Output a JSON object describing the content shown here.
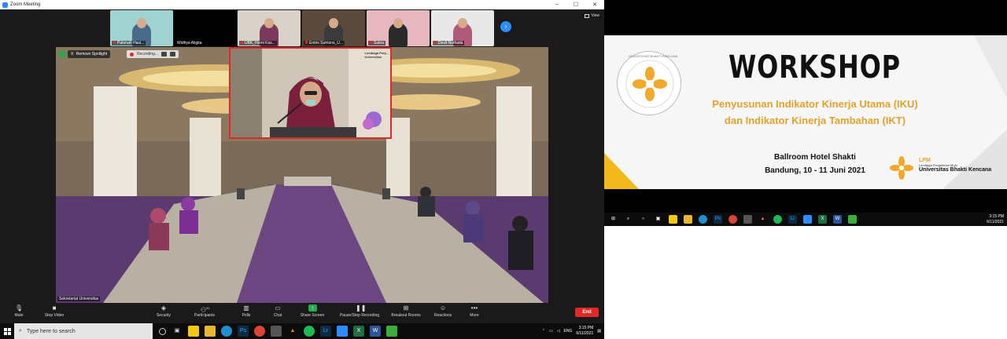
{
  "window": {
    "title": "Zoom Meeting",
    "controls": [
      "–",
      "☐",
      "✕"
    ]
  },
  "gallery": {
    "view_label": "View",
    "participants": [
      {
        "name": "Patonah Hasi...",
        "bg": "#9fd2d0",
        "outfit": "#4a6a8a"
      },
      {
        "name": "Widhya Aligita",
        "bg": "#000000",
        "outfit": "#000000"
      },
      {
        "name": "UBK_Hemi Kas...",
        "bg": "#d8d2c8",
        "outfit": "#7a3b5a"
      },
      {
        "name": "Entris Sutrisno_U...",
        "bg": "#5a4a3e",
        "outfit": "#3a3a3a"
      },
      {
        "name": "Sutna",
        "bg": "#e8b8c0",
        "outfit": "#2a2a2a"
      },
      {
        "name": "Devil Nurfaida",
        "bg": "#e8e8e8",
        "outfit": "#b05a7a"
      }
    ]
  },
  "spotlight": {
    "remove_label": "Remove Spotlight",
    "recording_label": "Recording...",
    "participant_label": "Sekretariat Universitas"
  },
  "pip": {
    "logo_line1": "Lembaga Penj...",
    "logo_line2": "Universitas"
  },
  "toolbar": {
    "mute": "Mute",
    "stop_video": "Stop Video",
    "security": "Security",
    "participants": "Participants",
    "participants_count": "41",
    "polls": "Polls",
    "chat": "Chat",
    "share_screen": "Share Screen",
    "recording": "Pause/Stop Recording",
    "breakout": "Breakout Rooms",
    "reactions": "Reactions",
    "more": "More",
    "end": "End"
  },
  "taskbar": {
    "search_placeholder": "Type here to search",
    "time": "3:15 PM",
    "date": "6/11/2021",
    "lang": "ENG"
  },
  "slide": {
    "title": "WORKSHOP",
    "subtitle1": "Penyusunan Indikator Kinerja Utama (IKU)",
    "subtitle2": "dan Indikator Kinerja Tambahan (IKT)",
    "venue": "Ballroom Hotel Shakti",
    "date": "Bandung, 10 - 11 Juni 2021",
    "lpm_short": "LPM",
    "lpm_full": "Lembaga Penjaminan Mutu",
    "university": "Universitas Bhakti Kencana",
    "ring_text": "UNIVERSITAS BHAKTI KENCANA"
  },
  "taskbar2": {
    "time": "3:15 PM",
    "date": "6/11/2021"
  },
  "colors": {
    "accent": "#2d8cff",
    "end": "#e02828",
    "gold": "#e3a12a",
    "share": "#23a94a"
  }
}
